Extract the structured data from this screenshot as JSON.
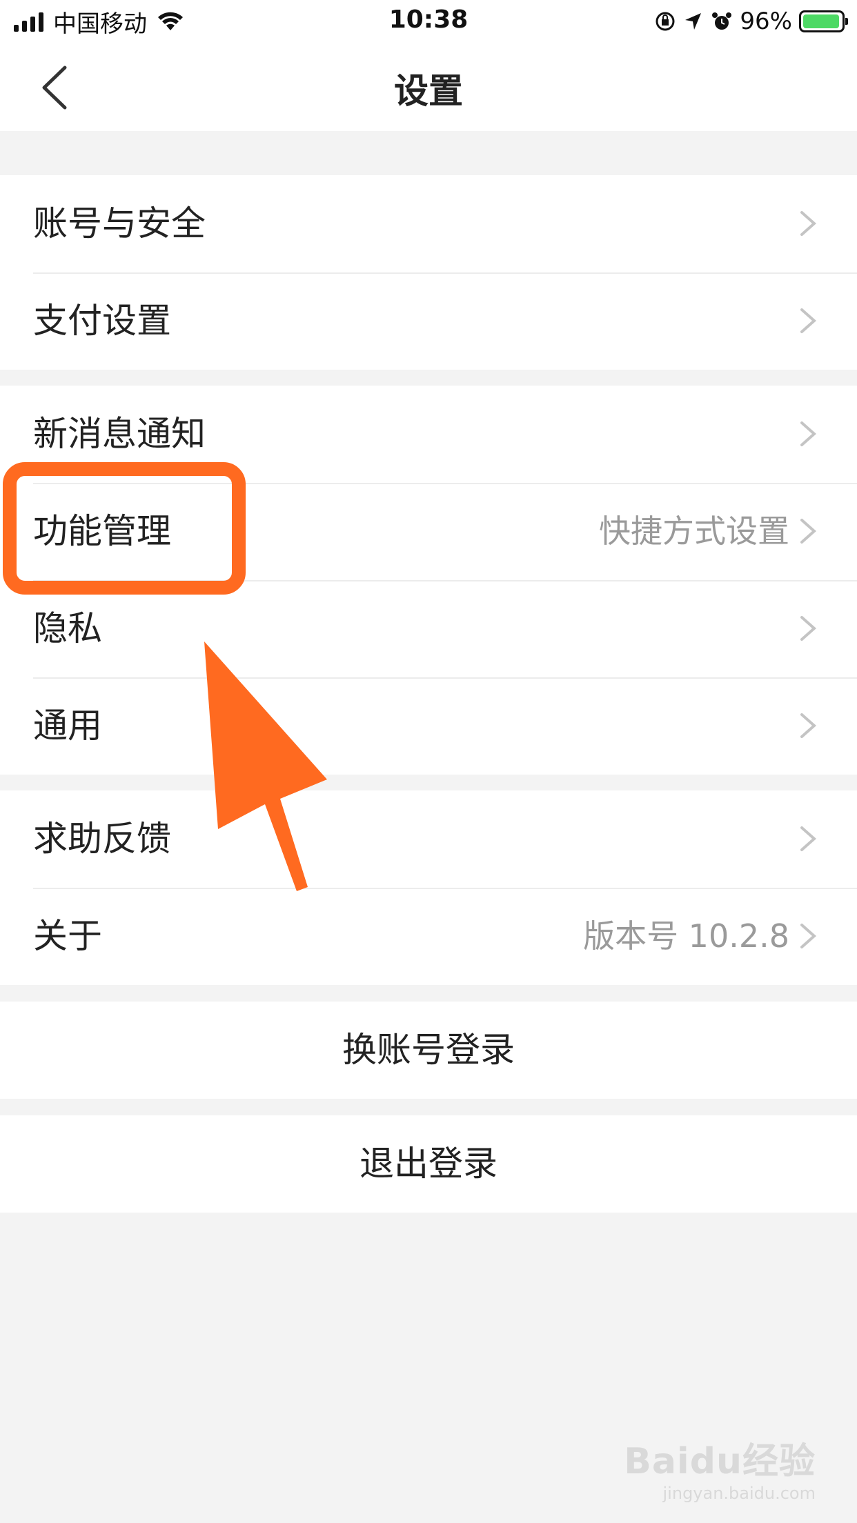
{
  "status_bar": {
    "carrier": "中国移动",
    "time": "10:38",
    "battery_percent": "96%",
    "battery_level": 0.96,
    "icons": [
      "signal-icon",
      "wifi-icon",
      "rotation-lock-icon",
      "location-icon",
      "alarm-icon",
      "battery-icon"
    ]
  },
  "nav": {
    "title": "设置",
    "back_icon": "chevron-left-icon"
  },
  "groups": [
    {
      "items": [
        {
          "label": "账号与安全",
          "value": ""
        },
        {
          "label": "支付设置",
          "value": ""
        }
      ]
    },
    {
      "items": [
        {
          "label": "新消息通知",
          "value": ""
        },
        {
          "label": "功能管理",
          "value": "快捷方式设置"
        },
        {
          "label": "隐私",
          "value": ""
        },
        {
          "label": "通用",
          "value": ""
        }
      ]
    },
    {
      "items": [
        {
          "label": "求助反馈",
          "value": ""
        },
        {
          "label": "关于",
          "value": "版本号 10.2.8"
        }
      ]
    }
  ],
  "buttons": {
    "switch_account": "换账号登录",
    "logout": "退出登录"
  },
  "annotation": {
    "highlight_color": "#ff6a20",
    "highlighted_item": "功能管理"
  },
  "watermark": {
    "main": "Baidu经验",
    "sub": "jingyan.baidu.com"
  }
}
